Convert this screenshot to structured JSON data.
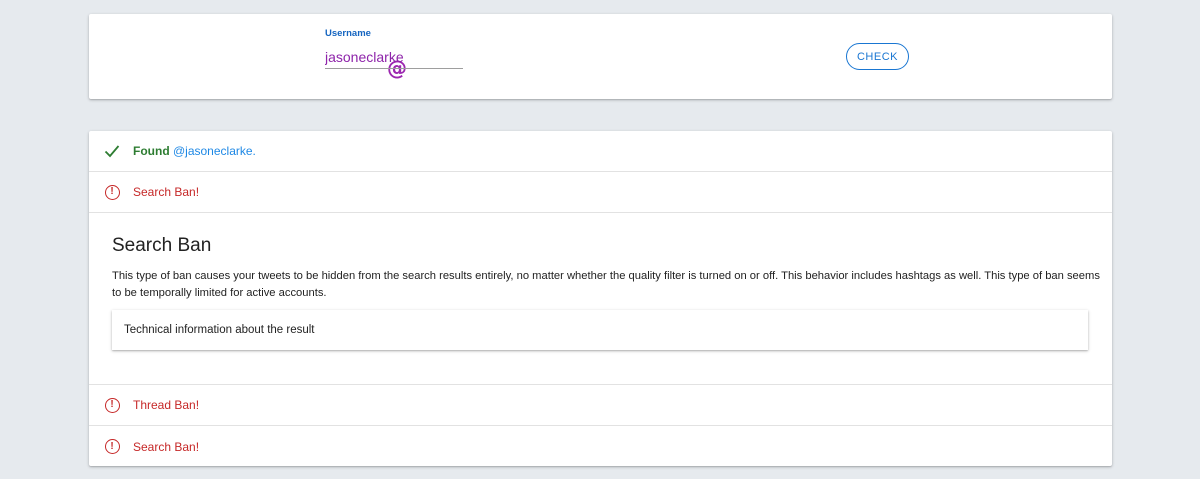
{
  "search": {
    "label": "Username",
    "value": "jasoneclarke",
    "at_symbol": "@",
    "button": "CHECK"
  },
  "results": {
    "found_prefix": "Found ",
    "found_user": "@jasoneclarke",
    "found_suffix": ".",
    "row2": "Search Ban!",
    "detail": {
      "title": "Search Ban",
      "body": "This type of ban causes your tweets to be hidden from the search results entirely, no matter whether the quality filter is turned on or off. This behavior includes hashtags as well. This type of ban seems to be temporally limited for active accounts.",
      "tech_label": "Technical information about the result"
    },
    "row3": "Thread Ban!",
    "row4": "Search Ban!"
  },
  "icons": {
    "check": "check-icon",
    "error": "error-circle-icon",
    "error_glyph": "!"
  },
  "colors": {
    "background": "#e6eaee",
    "accent": "#1976d2",
    "success": "#2e7d32",
    "error": "#c62828",
    "username": "#8e24aa"
  }
}
